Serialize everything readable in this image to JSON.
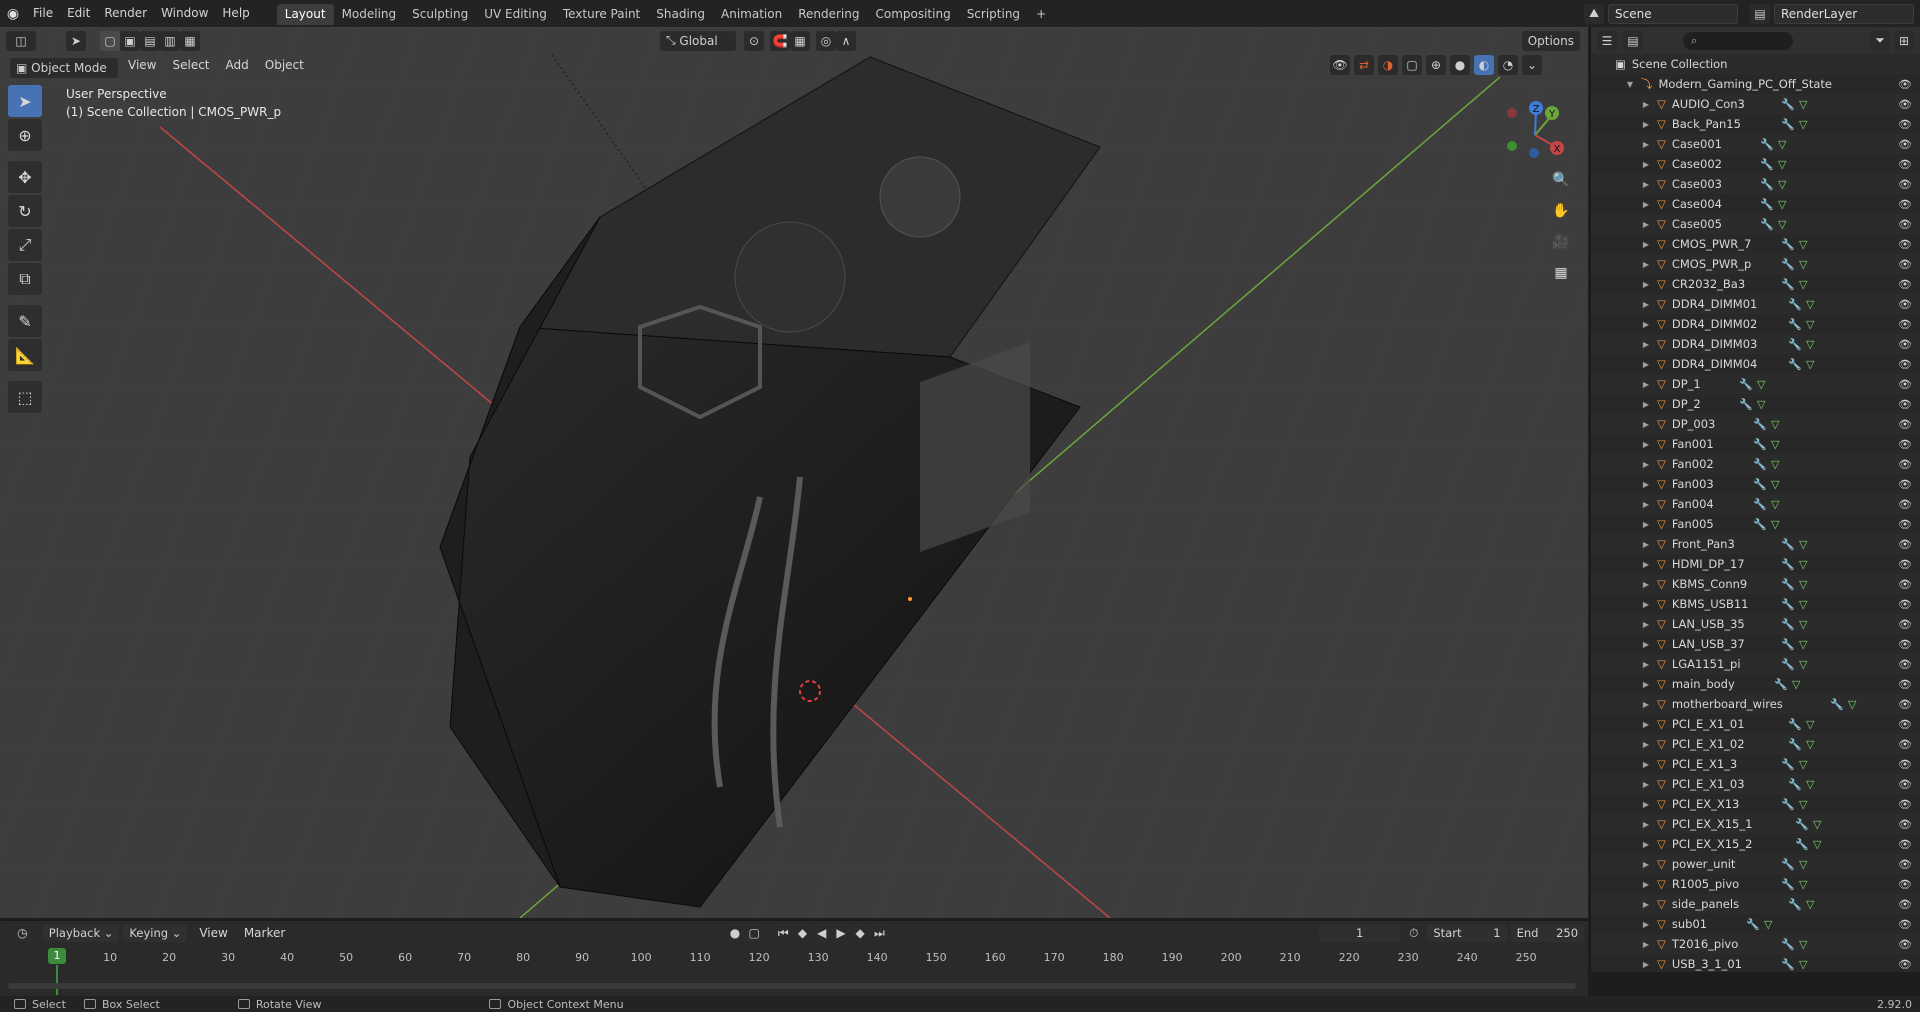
{
  "topbar": {
    "menus": [
      "File",
      "Edit",
      "Render",
      "Window",
      "Help"
    ],
    "workspace_tabs": [
      "Layout",
      "Modeling",
      "Sculpting",
      "UV Editing",
      "Texture Paint",
      "Shading",
      "Animation",
      "Rendering",
      "Compositing",
      "Scripting"
    ],
    "active_tab": "Layout",
    "add_tab": "+",
    "scene_name": "Scene",
    "view_layer": "RenderLayer"
  },
  "viewport": {
    "mode": "Object Mode",
    "menus": [
      "View",
      "Select",
      "Add",
      "Object"
    ],
    "transform_orientation": "Global",
    "options_label": "Options",
    "info_line1": "User Perspective",
    "info_line2": "(1) Scene Collection | CMOS_PWR_p",
    "gizmo_axes": {
      "x": "X",
      "y": "Y",
      "z": "Z"
    },
    "colors": {
      "background": "#3d3d3d",
      "x_axis": "#c24646",
      "y_axis": "#6ba63a",
      "z_axis": "#3f7dd8",
      "active_tool": "#4772b3"
    }
  },
  "toolbar": {
    "tools": [
      "select-box",
      "cursor",
      "move",
      "rotate",
      "scale",
      "transform",
      "annotate",
      "measure",
      "add-cube"
    ]
  },
  "outliner": {
    "root": "Scene Collection",
    "collection": "Modern_Gaming_PC_Off_State",
    "items": [
      "AUDIO_Con3",
      "Back_Pan15",
      "Case001",
      "Case002",
      "Case003",
      "Case004",
      "Case005",
      "CMOS_PWR_7",
      "CMOS_PWR_p",
      "CR2032_Ba3",
      "DDR4_DIMM01",
      "DDR4_DIMM02",
      "DDR4_DIMM03",
      "DDR4_DIMM04",
      "DP_1",
      "DP_2",
      "DP_003",
      "Fan001",
      "Fan002",
      "Fan003",
      "Fan004",
      "Fan005",
      "Front_Pan3",
      "HDMI_DP_17",
      "KBMS_Conn9",
      "KBMS_USB11",
      "LAN_USB_35",
      "LAN_USB_37",
      "LGA1151_pi",
      "main_body",
      "motherboard_wires",
      "PCI_E_X1_01",
      "PCI_E_X1_02",
      "PCI_E_X1_3",
      "PCI_E_X1_03",
      "PCI_EX_X13",
      "PCI_EX_X15_1",
      "PCI_EX_X15_2",
      "power_unit",
      "R1005_pivo",
      "side_panels",
      "sub01",
      "T2016_pivo",
      "USB_3_1_01"
    ]
  },
  "timeline": {
    "menus": [
      "Playback",
      "Keying",
      "View",
      "Marker"
    ],
    "current_frame": "1",
    "start_label": "Start",
    "start": "1",
    "end_label": "End",
    "end": "250",
    "ruler": [
      "1",
      "10",
      "20",
      "30",
      "40",
      "50",
      "60",
      "70",
      "80",
      "90",
      "100",
      "110",
      "120",
      "130",
      "140",
      "150",
      "160",
      "170",
      "180",
      "190",
      "200",
      "210",
      "220",
      "230",
      "240",
      "250"
    ]
  },
  "statusbar": {
    "items": [
      "Select",
      "Box Select",
      "Rotate View",
      "Object Context Menu"
    ],
    "version": "2.92.0"
  }
}
